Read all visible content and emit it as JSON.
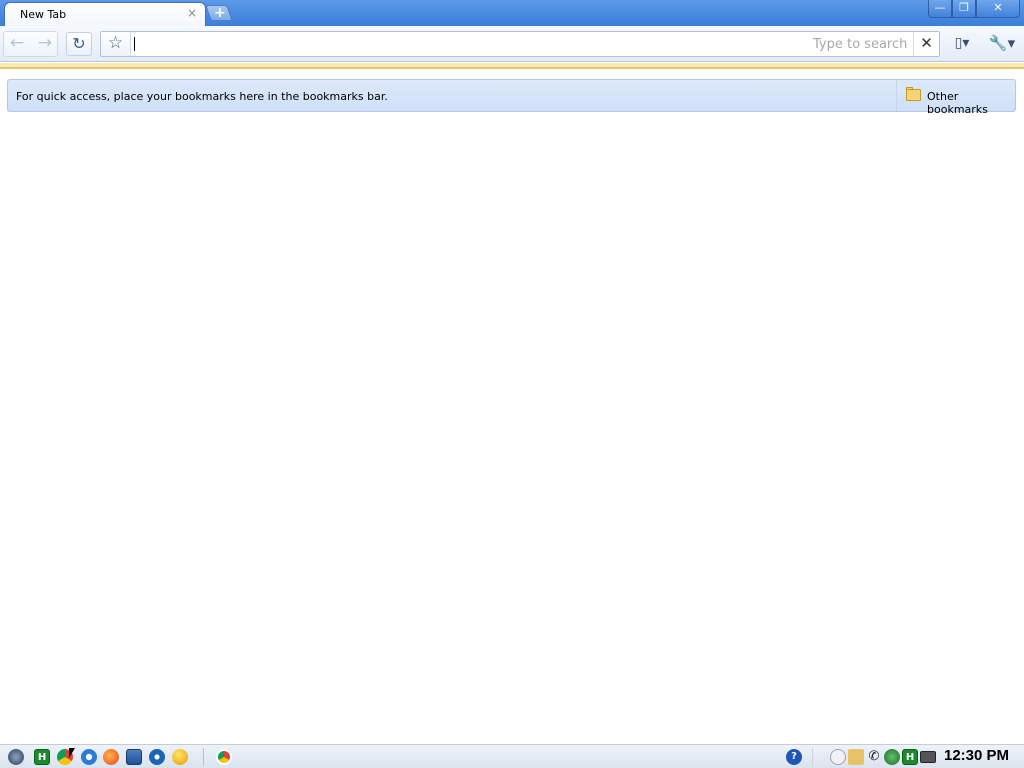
{
  "window": {
    "tab_title": "New Tab",
    "tab_close": "×",
    "new_tab": "+",
    "minimize": "—",
    "maximize": "❐",
    "close": "✕"
  },
  "toolbar": {
    "back": "←",
    "forward": "→",
    "reload": "↻",
    "star": "☆",
    "omnibox_value": "",
    "search_placeholder": "Type to search",
    "clear_search": "✕",
    "page_menu": "▯▾",
    "wrench_menu": "🔧▾"
  },
  "bookmarks_bar": {
    "hint": "For quick access, place your bookmarks here in the bookmarks bar.",
    "other_bookmarks": "Other bookmarks"
  },
  "taskbar": {
    "launcher_h": "H",
    "help": "?",
    "tray_h": "H",
    "clock": "12:30 PM"
  },
  "colors": {
    "titlebar": "#3a7ed9",
    "bookmarks_bar": "#d6e4f8",
    "infobar": "#fbe9b4"
  }
}
